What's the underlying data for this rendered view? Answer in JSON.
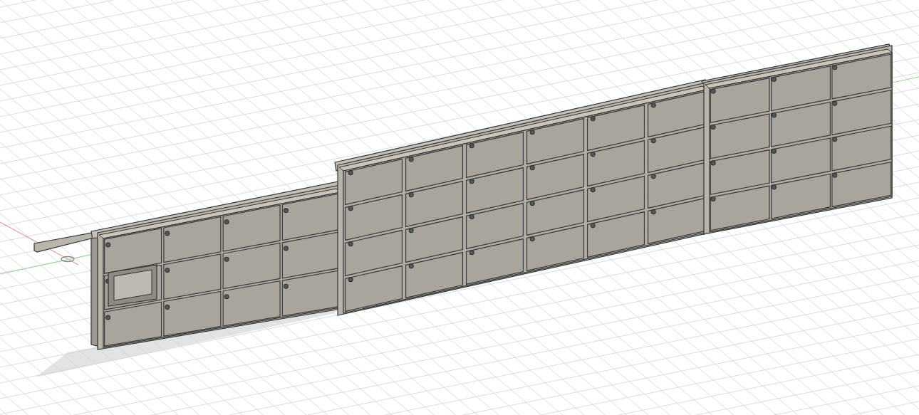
{
  "viewport": {
    "kind": "perspective-grid"
  },
  "model": {
    "kind": "locker-wall"
  }
}
